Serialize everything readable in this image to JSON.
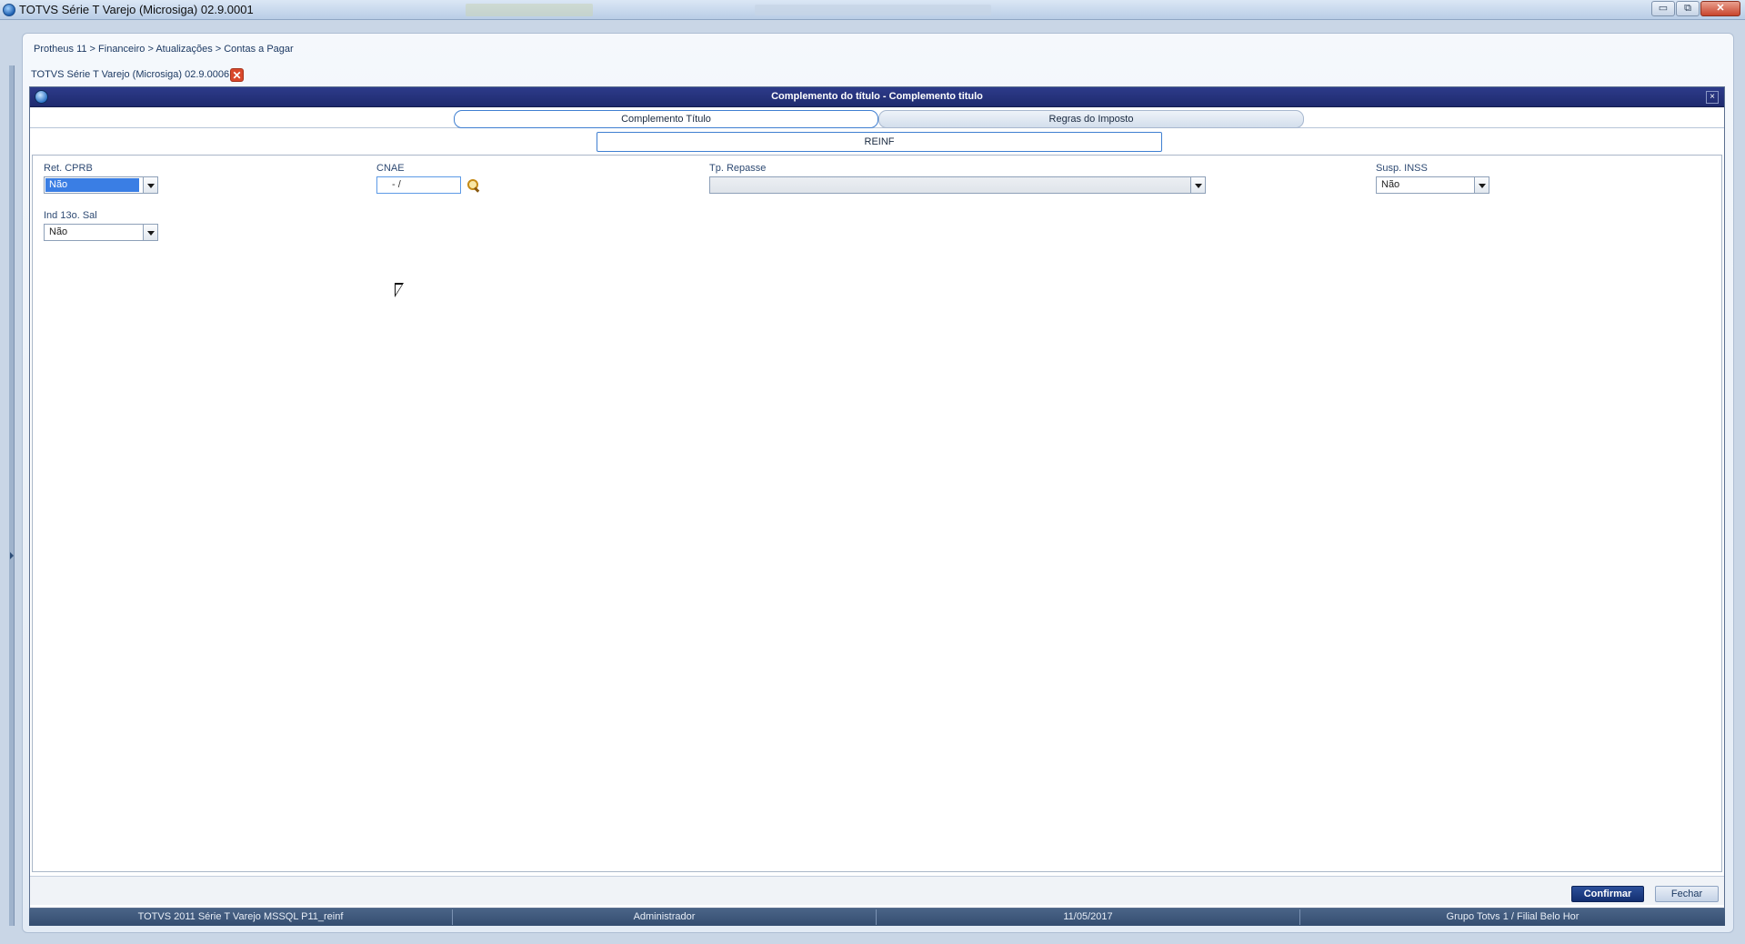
{
  "window": {
    "title": "TOTVS Série T Varejo (Microsiga) 02.9.0001",
    "controls": {
      "minimize": "▭",
      "maximize": "⧉",
      "close": "✕"
    }
  },
  "breadcrumb": "Protheus 11 > Financeiro > Atualizações > Contas a Pagar",
  "document_tab": {
    "label": "TOTVS Série T Varejo (Microsiga) 02.9.0006",
    "close": "✕"
  },
  "dialog": {
    "title": "Complemento do título - Complemento titulo",
    "close": "×",
    "tabs": [
      {
        "label": "Complemento Título",
        "active": true
      },
      {
        "label": "Regras do Imposto",
        "active": false
      }
    ],
    "subtab": "REINF",
    "fields": {
      "ret_cprb": {
        "label": "Ret. CPRB",
        "value": "Não"
      },
      "cnae": {
        "label": "CNAE",
        "value": "- /"
      },
      "tp_repasse": {
        "label": "Tp. Repasse",
        "value": ""
      },
      "susp_inss": {
        "label": "Susp. INSS",
        "value": "Não"
      },
      "ind_13o_sal": {
        "label": "Ind 13o. Sal",
        "value": "Não"
      }
    },
    "buttons": {
      "confirm": "Confirmar",
      "close": "Fechar"
    }
  },
  "statusbar": {
    "environment": "TOTVS 2011 Série T Varejo MSSQL P11_reinf",
    "user": "Administrador",
    "date": "11/05/2017",
    "company": "Grupo Totvs 1 / Filial Belo Hor"
  },
  "icons": [
    "app-icon",
    "close-icon",
    "search-icon",
    "chevron-down-icon",
    "mouse-cursor-icon"
  ],
  "colors": {
    "dialog_header": "#1e2a6e",
    "accent": "#3f7fd1",
    "primary_button": "#132f70",
    "selection": "#3a7ee4"
  }
}
